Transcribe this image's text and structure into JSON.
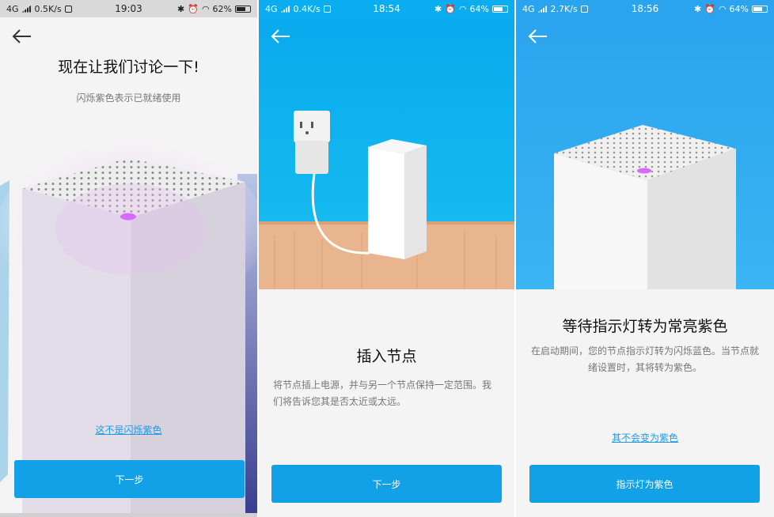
{
  "panels": [
    {
      "status": {
        "network": "4G",
        "speed": "0.5K/s",
        "time": "19:03",
        "battery": "62%"
      },
      "title": "现在让我们讨论一下!",
      "subtitle": "闪烁紫色表示已就绪使用",
      "link": "这不是闪烁紫色",
      "button": "下一步"
    },
    {
      "status": {
        "network": "4G",
        "speed": "0.4K/s",
        "time": "18:54",
        "battery": "64%"
      },
      "title": "插入节点",
      "subtitle": "将节点插上电源，并与另一个节点保持一定范围。我们将告诉您其是否太近或太远。",
      "button": "下一步"
    },
    {
      "status": {
        "network": "4G",
        "speed": "2.7K/s",
        "time": "18:56",
        "battery": "64%"
      },
      "title": "等待指示灯转为常亮紫色",
      "subtitle": "在启动期间，您的节点指示灯转为闪烁蓝色。当节点就绪设置时，其将转为紫色。",
      "link": "其不会变为紫色",
      "button": "指示灯为紫色"
    }
  ],
  "icons": {
    "back": "back-arrow-icon",
    "signal": "signal-icon",
    "bluetooth": "bluetooth-icon",
    "alarm": "alarm-icon",
    "wifi": "wifi-icon",
    "battery": "battery-icon"
  },
  "colors": {
    "accent": "#12a0e6",
    "link": "#1d9be3",
    "led_purple": "#d56bff",
    "sky_blue": "#0aaef0",
    "table_wood": "#e8b58e"
  }
}
